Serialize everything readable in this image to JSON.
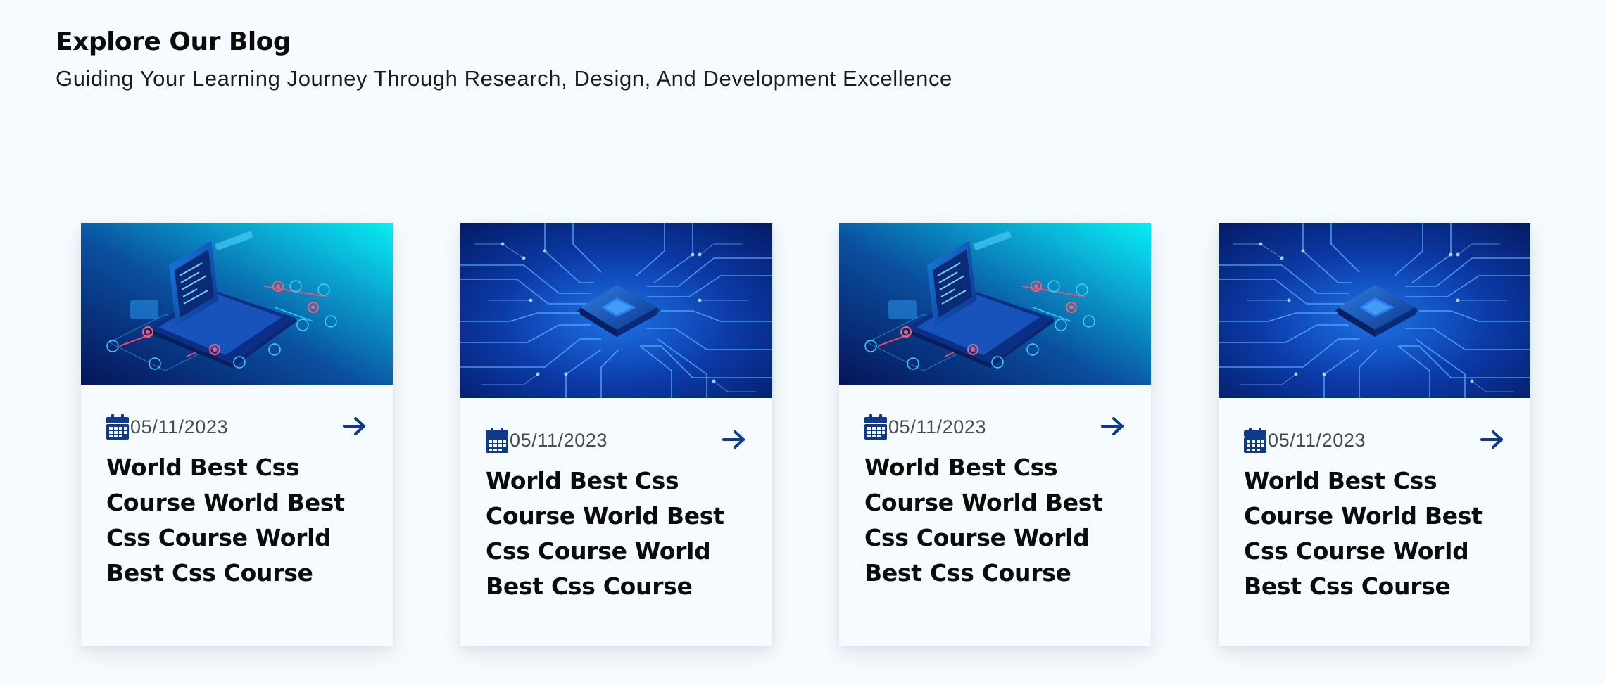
{
  "header": {
    "title": "Explore Our Blog",
    "subtitle": "Guiding Your Learning Journey Through Research, Design, And Development Excellence"
  },
  "posts": [
    {
      "date": "05/11/2023",
      "title": "World Best Css Course World Best Css Course World Best Css Course",
      "image": "laptop-illustration"
    },
    {
      "date": "05/11/2023",
      "title": "World Best Css Course World Best Css Course World Best Css Course",
      "image": "circuit-chip-illustration"
    },
    {
      "date": "05/11/2023",
      "title": "World Best Css Course World Best Css Course World Best Css Course",
      "image": "laptop-illustration"
    },
    {
      "date": "05/11/2023",
      "title": "World Best Css Course World Best Css Course World Best Css Course",
      "image": "circuit-chip-illustration"
    }
  ],
  "icons": {
    "date": "calendar-icon",
    "read_more": "arrow-right-icon"
  },
  "colors": {
    "background": "#f5fbfe",
    "accent": "#0d3a8c",
    "title_text": "#0b0b0b",
    "date_text": "#4a4a4a"
  }
}
